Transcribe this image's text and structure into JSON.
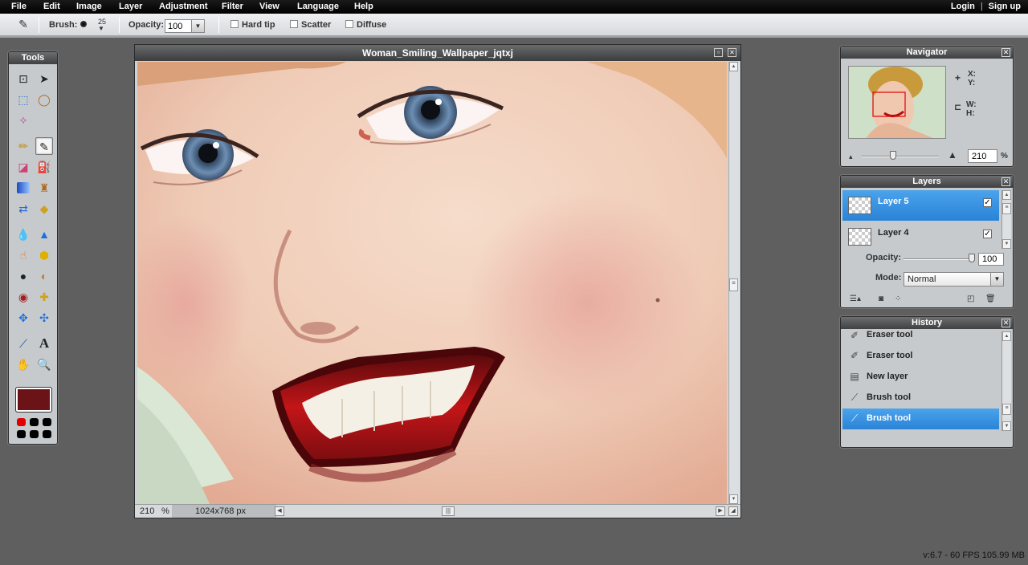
{
  "menubar": {
    "items": [
      "File",
      "Edit",
      "Image",
      "Layer",
      "Adjustment",
      "Filter",
      "View",
      "Language",
      "Help"
    ],
    "login": "Login",
    "separator": "|",
    "signup": "Sign up"
  },
  "toolbar": {
    "brush_label": "Brush:",
    "brush_size": "25",
    "opacity_label": "Opacity:",
    "opacity_value": "100",
    "hard_tip": "Hard tip",
    "scatter": "Scatter",
    "diffuse": "Diffuse"
  },
  "tools": {
    "title": "Tools",
    "primary_color": "#6b1317",
    "swatch_colors": [
      "#e00000",
      "#000000",
      "#000000",
      "#000000",
      "#000000",
      "#000000"
    ],
    "text_tool_glyph": "A"
  },
  "document": {
    "title": "Woman_Smiling_Wallpaper_jqtxj",
    "zoom": "210",
    "zoom_unit": "%",
    "size_info": "1024x768 px"
  },
  "navigator": {
    "title": "Navigator",
    "x_label": "X:",
    "y_label": "Y:",
    "w_label": "W:",
    "h_label": "H:",
    "zoom_value": "210",
    "zoom_unit": "%"
  },
  "layers": {
    "title": "Layers",
    "items": [
      {
        "name": "Layer 5",
        "visible": true,
        "selected": true
      },
      {
        "name": "Layer 4",
        "visible": true,
        "selected": false
      }
    ],
    "opacity_label": "Opacity:",
    "opacity_value": "100",
    "mode_label": "Mode:",
    "mode_value": "Normal"
  },
  "history": {
    "title": "History",
    "items": [
      {
        "label": "Eraser tool",
        "icon": "eraser-icon"
      },
      {
        "label": "Eraser tool",
        "icon": "eraser-icon"
      },
      {
        "label": "New layer",
        "icon": "new-layer-icon"
      },
      {
        "label": "Brush tool",
        "icon": "brush-icon"
      },
      {
        "label": "Brush tool",
        "icon": "brush-icon",
        "selected": true
      }
    ]
  },
  "footer": {
    "version": "v:6.7 - 60 FPS 105.99 MB"
  }
}
